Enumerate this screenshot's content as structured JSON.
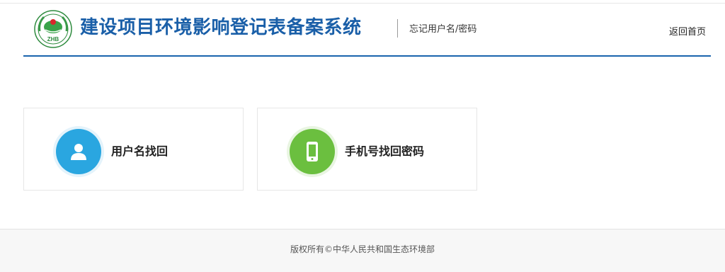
{
  "header": {
    "logo_text": "ZHB",
    "site_title": "建设项目环境影响登记表备案系统",
    "page_subtitle": "忘记用户名/密码",
    "home_link": "返回首页"
  },
  "options": [
    {
      "label": "用户名找回",
      "icon": "user-icon",
      "color": "#2aa6e0"
    },
    {
      "label": "手机号找回密码",
      "icon": "mobile-phone-icon",
      "color": "#6bbf3f"
    }
  ],
  "footer": {
    "copyright": "版权所有©中华人民共和国生态环境部"
  },
  "colors": {
    "brand": "#1a5fa8",
    "rule": "#1a64ad"
  }
}
